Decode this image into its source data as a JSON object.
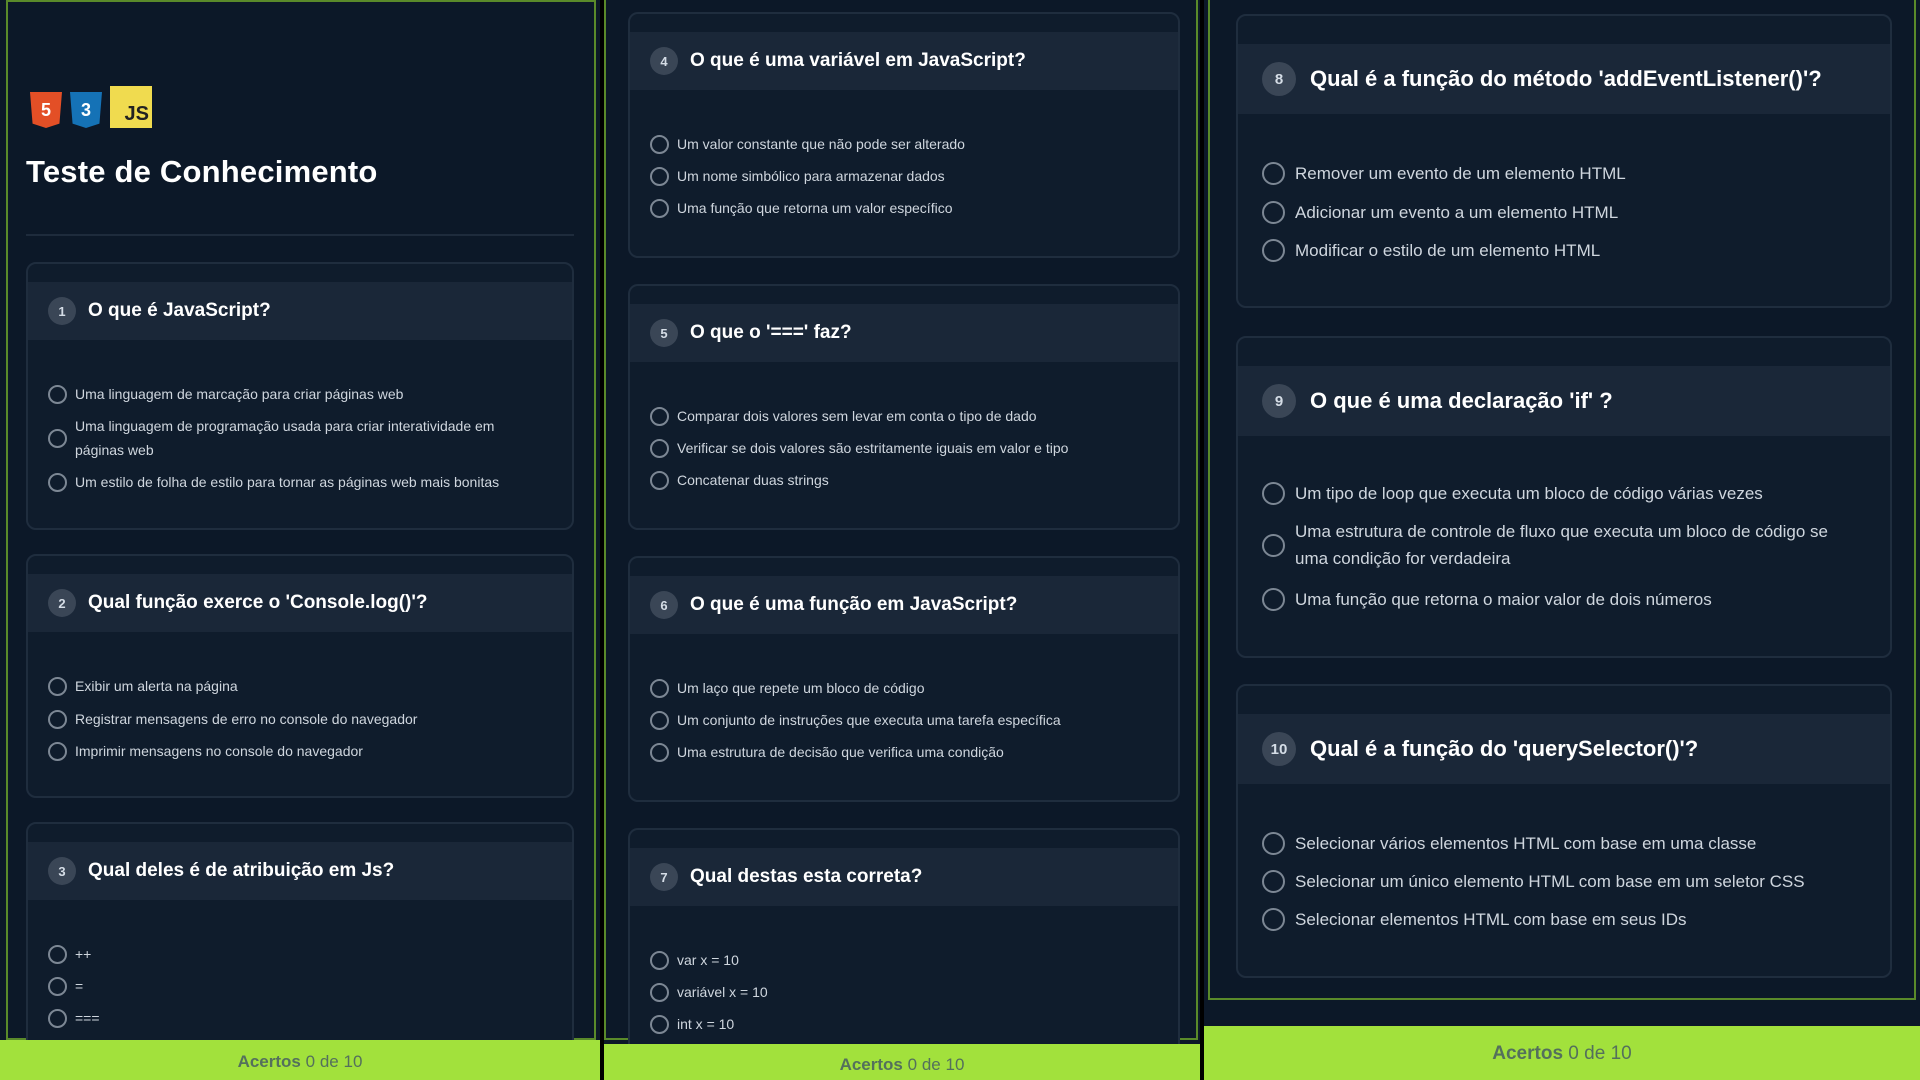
{
  "header": {
    "logos": [
      {
        "icon": "html5-logo",
        "text": "5"
      },
      {
        "icon": "css3-logo",
        "text": "3"
      },
      {
        "icon": "js-logo",
        "text": "JS"
      }
    ],
    "title": "Teste de Conhecimento"
  },
  "colors": {
    "background": "#0c1828",
    "card": "#0f1c2c",
    "card_header": "#1a2738",
    "footer": "#a2e13c",
    "frame_border": "#5a8a2a"
  },
  "questions": [
    {
      "number": "1",
      "question": "O que é JavaScript?",
      "options": [
        "Uma linguagem de marcação para criar páginas web",
        "Uma linguagem de programação usada para criar interatividade em páginas web",
        "Um estilo de folha de estilo para tornar as páginas web mais bonitas"
      ]
    },
    {
      "number": "2",
      "question": "Qual função exerce o 'Console.log()'?",
      "options": [
        "Exibir um alerta na página",
        "Registrar mensagens de erro no console do navegador",
        "Imprimir mensagens no console do navegador"
      ]
    },
    {
      "number": "3",
      "question": "Qual deles é de atribuição em Js?",
      "options": [
        "++",
        "=",
        "==="
      ]
    },
    {
      "number": "4",
      "question": "O que é uma variável em JavaScript?",
      "options": [
        "Um valor constante que não pode ser alterado",
        "Um nome simbólico para armazenar dados",
        "Uma função que retorna um valor específico"
      ]
    },
    {
      "number": "5",
      "question": "O que o '===' faz?",
      "options": [
        "Comparar dois valores sem levar em conta o tipo de dado",
        "Verificar se dois valores são estritamente iguais em valor e tipo",
        "Concatenar duas strings"
      ]
    },
    {
      "number": "6",
      "question": "O que é uma função em JavaScript?",
      "options": [
        "Um laço que repete um bloco de código",
        "Um conjunto de instruções que executa uma tarefa específica",
        "Uma estrutura de decisão que verifica uma condição"
      ]
    },
    {
      "number": "7",
      "question": "Qual destas esta correta?",
      "options": [
        "var x = 10",
        "variável x = 10",
        "int x = 10"
      ]
    },
    {
      "number": "8",
      "question": "Qual é a função do método 'addEventListener()'?",
      "options": [
        "Remover um evento de um elemento HTML",
        "Adicionar um evento a um elemento HTML",
        "Modificar o estilo de um elemento HTML"
      ]
    },
    {
      "number": "9",
      "question": "O que é uma declaração 'if' ?",
      "options": [
        "Um tipo de loop que executa um bloco de código várias vezes",
        "Uma estrutura de controle de fluxo que executa um bloco de código se uma condição for verdadeira",
        "Uma função que retorna o maior valor de dois números"
      ]
    },
    {
      "number": "10",
      "question": "Qual é a função do 'querySelector()'?",
      "options": [
        "Selecionar vários elementos HTML com base em uma classe",
        "Selecionar um único elemento HTML com base em um seletor CSS",
        "Selecionar elementos HTML com base em seus IDs"
      ]
    }
  ],
  "score": {
    "label": "Acertos",
    "correct": "0",
    "separator": "de",
    "total": "10"
  }
}
